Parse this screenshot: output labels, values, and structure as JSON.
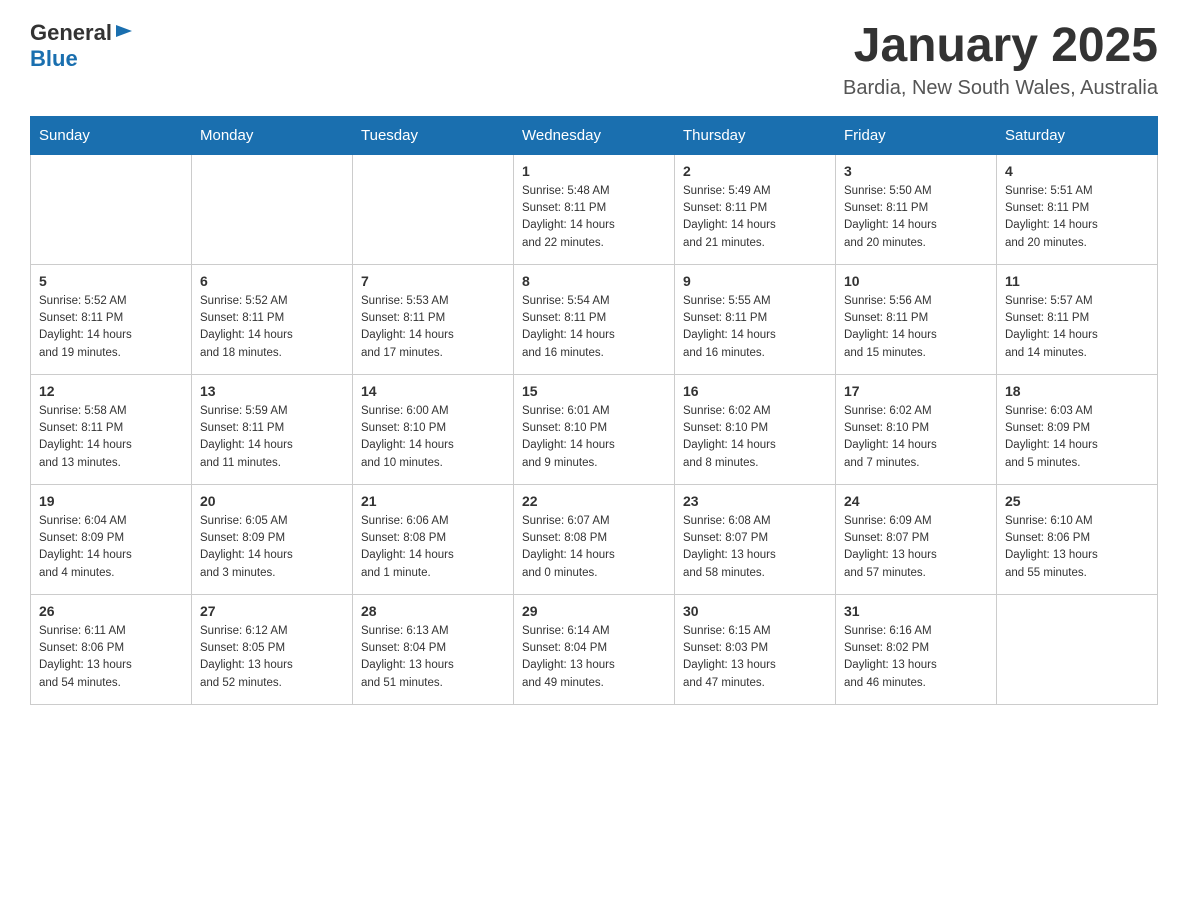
{
  "header": {
    "logo_general": "General",
    "logo_blue": "Blue",
    "month_title": "January 2025",
    "location": "Bardia, New South Wales, Australia"
  },
  "days_of_week": [
    "Sunday",
    "Monday",
    "Tuesday",
    "Wednesday",
    "Thursday",
    "Friday",
    "Saturday"
  ],
  "weeks": [
    [
      {
        "day": "",
        "info": ""
      },
      {
        "day": "",
        "info": ""
      },
      {
        "day": "",
        "info": ""
      },
      {
        "day": "1",
        "info": "Sunrise: 5:48 AM\nSunset: 8:11 PM\nDaylight: 14 hours\nand 22 minutes."
      },
      {
        "day": "2",
        "info": "Sunrise: 5:49 AM\nSunset: 8:11 PM\nDaylight: 14 hours\nand 21 minutes."
      },
      {
        "day": "3",
        "info": "Sunrise: 5:50 AM\nSunset: 8:11 PM\nDaylight: 14 hours\nand 20 minutes."
      },
      {
        "day": "4",
        "info": "Sunrise: 5:51 AM\nSunset: 8:11 PM\nDaylight: 14 hours\nand 20 minutes."
      }
    ],
    [
      {
        "day": "5",
        "info": "Sunrise: 5:52 AM\nSunset: 8:11 PM\nDaylight: 14 hours\nand 19 minutes."
      },
      {
        "day": "6",
        "info": "Sunrise: 5:52 AM\nSunset: 8:11 PM\nDaylight: 14 hours\nand 18 minutes."
      },
      {
        "day": "7",
        "info": "Sunrise: 5:53 AM\nSunset: 8:11 PM\nDaylight: 14 hours\nand 17 minutes."
      },
      {
        "day": "8",
        "info": "Sunrise: 5:54 AM\nSunset: 8:11 PM\nDaylight: 14 hours\nand 16 minutes."
      },
      {
        "day": "9",
        "info": "Sunrise: 5:55 AM\nSunset: 8:11 PM\nDaylight: 14 hours\nand 16 minutes."
      },
      {
        "day": "10",
        "info": "Sunrise: 5:56 AM\nSunset: 8:11 PM\nDaylight: 14 hours\nand 15 minutes."
      },
      {
        "day": "11",
        "info": "Sunrise: 5:57 AM\nSunset: 8:11 PM\nDaylight: 14 hours\nand 14 minutes."
      }
    ],
    [
      {
        "day": "12",
        "info": "Sunrise: 5:58 AM\nSunset: 8:11 PM\nDaylight: 14 hours\nand 13 minutes."
      },
      {
        "day": "13",
        "info": "Sunrise: 5:59 AM\nSunset: 8:11 PM\nDaylight: 14 hours\nand 11 minutes."
      },
      {
        "day": "14",
        "info": "Sunrise: 6:00 AM\nSunset: 8:10 PM\nDaylight: 14 hours\nand 10 minutes."
      },
      {
        "day": "15",
        "info": "Sunrise: 6:01 AM\nSunset: 8:10 PM\nDaylight: 14 hours\nand 9 minutes."
      },
      {
        "day": "16",
        "info": "Sunrise: 6:02 AM\nSunset: 8:10 PM\nDaylight: 14 hours\nand 8 minutes."
      },
      {
        "day": "17",
        "info": "Sunrise: 6:02 AM\nSunset: 8:10 PM\nDaylight: 14 hours\nand 7 minutes."
      },
      {
        "day": "18",
        "info": "Sunrise: 6:03 AM\nSunset: 8:09 PM\nDaylight: 14 hours\nand 5 minutes."
      }
    ],
    [
      {
        "day": "19",
        "info": "Sunrise: 6:04 AM\nSunset: 8:09 PM\nDaylight: 14 hours\nand 4 minutes."
      },
      {
        "day": "20",
        "info": "Sunrise: 6:05 AM\nSunset: 8:09 PM\nDaylight: 14 hours\nand 3 minutes."
      },
      {
        "day": "21",
        "info": "Sunrise: 6:06 AM\nSunset: 8:08 PM\nDaylight: 14 hours\nand 1 minute."
      },
      {
        "day": "22",
        "info": "Sunrise: 6:07 AM\nSunset: 8:08 PM\nDaylight: 14 hours\nand 0 minutes."
      },
      {
        "day": "23",
        "info": "Sunrise: 6:08 AM\nSunset: 8:07 PM\nDaylight: 13 hours\nand 58 minutes."
      },
      {
        "day": "24",
        "info": "Sunrise: 6:09 AM\nSunset: 8:07 PM\nDaylight: 13 hours\nand 57 minutes."
      },
      {
        "day": "25",
        "info": "Sunrise: 6:10 AM\nSunset: 8:06 PM\nDaylight: 13 hours\nand 55 minutes."
      }
    ],
    [
      {
        "day": "26",
        "info": "Sunrise: 6:11 AM\nSunset: 8:06 PM\nDaylight: 13 hours\nand 54 minutes."
      },
      {
        "day": "27",
        "info": "Sunrise: 6:12 AM\nSunset: 8:05 PM\nDaylight: 13 hours\nand 52 minutes."
      },
      {
        "day": "28",
        "info": "Sunrise: 6:13 AM\nSunset: 8:04 PM\nDaylight: 13 hours\nand 51 minutes."
      },
      {
        "day": "29",
        "info": "Sunrise: 6:14 AM\nSunset: 8:04 PM\nDaylight: 13 hours\nand 49 minutes."
      },
      {
        "day": "30",
        "info": "Sunrise: 6:15 AM\nSunset: 8:03 PM\nDaylight: 13 hours\nand 47 minutes."
      },
      {
        "day": "31",
        "info": "Sunrise: 6:16 AM\nSunset: 8:02 PM\nDaylight: 13 hours\nand 46 minutes."
      },
      {
        "day": "",
        "info": ""
      }
    ]
  ]
}
